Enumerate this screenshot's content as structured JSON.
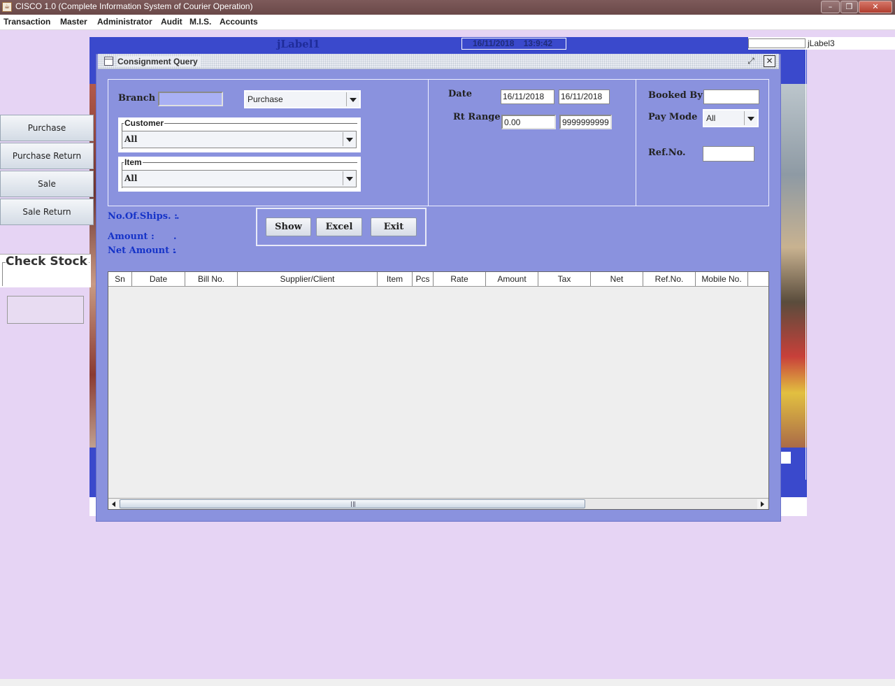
{
  "window": {
    "title": "CISCO 1.0 (Complete Information System of Courier Operation)"
  },
  "menu": [
    "Transaction",
    "Master",
    "Administrator",
    "Audit",
    "M.I.S.",
    "Accounts"
  ],
  "desktop": {
    "label1": "jLabel1",
    "date_time": "16/11/2018    13:9:42",
    "label3": "jLabel3"
  },
  "sidebar": {
    "buttons": [
      "Purchase",
      "Purchase Return",
      "Sale",
      "Sale Return"
    ],
    "check_stock": "Check Stock"
  },
  "dialog": {
    "title": "Consignment Query",
    "branch_label": "Branch",
    "branch_value": "",
    "type_value": "Purchase",
    "customer_title": "Customer",
    "customer_value": "All",
    "item_title": "Item",
    "item_value": "All",
    "date_label": "Date",
    "date_from": "16/11/2018",
    "date_to": "16/11/2018",
    "rt_range_label": "Rt Range",
    "rt_from": "0.00",
    "rt_to": "9999999999",
    "booked_by_label": "Booked By",
    "booked_by_value": "",
    "pay_mode_label": "Pay Mode",
    "pay_mode_value": "All",
    "ref_no_label": "Ref.No.",
    "ref_no_value": "",
    "stats": {
      "ships_label": "No.Of.Ships. :",
      "ships_value": ".",
      "amount_label": "Amount  :",
      "amount_value": ".",
      "net_amount_label": "Net Amount  :",
      "net_amount_value": "."
    },
    "buttons": {
      "show": "Show",
      "excel": "Excel",
      "exit": "Exit"
    },
    "table": {
      "columns": [
        "Sn",
        "Date",
        "Bill No.",
        "Supplier/Client",
        "Item",
        "Pcs",
        "Rate",
        "Amount",
        "Tax",
        "Net",
        "Ref.No.",
        "Mobile No."
      ],
      "rows": []
    }
  },
  "colors": {
    "panel": "#8a92de",
    "stats_text": "#1533c8",
    "desktop_blue": "#3a49cc",
    "background": "#e6d4f4"
  }
}
